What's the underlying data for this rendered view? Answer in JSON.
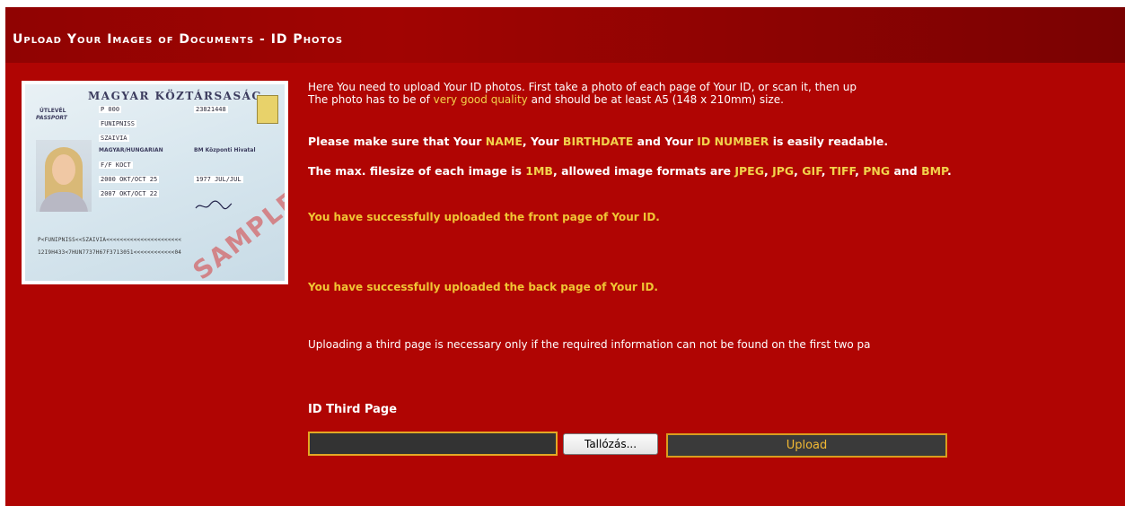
{
  "page": {
    "title": "Upload Your Images of Documents - ID Photos"
  },
  "sample_card": {
    "country": "MAGYAR KÖZTÁRSASÁG",
    "type_line1": "ÚTLEVÉL",
    "type_line2": "PASSPORT",
    "code": "P   000",
    "number": "23821448",
    "surname": "FUNIPNISS",
    "given_name": "SZAIVIA",
    "nationality": "MAGYAR/HUNGARIAN",
    "authority": "BM Központi Hivatal",
    "sex_place": "F/F    KOCT",
    "issue_date": "2000 OKT/OCT 25",
    "birth_date": "1977 JUL/JUL",
    "expiry_date": "2007 OKT/OCT 22",
    "mrz_line1": "P<FUNIPNISS<<SZAIVIA<<<<<<<<<<<<<<<<<<<<<<",
    "mrz_line2": "12I9H433<7HUN7737H67F3713051<<<<<<<<<<<<04",
    "stamp": "SAMPLE"
  },
  "intro": {
    "line1": "Here You need to upload Your ID photos. First take a photo of each page of Your ID, or scan it, then up",
    "line2_before": "The photo has to be of ",
    "line2_highlight": "very good quality",
    "line2_after": " and should be at least A5 (148 x 210mm) size."
  },
  "make_sure": {
    "t1": "Please make sure that Your ",
    "h1": "NAME",
    "t2": ", Your ",
    "h2": "BIRTHDATE",
    "t3": " and Your ",
    "h3": "ID NUMBER",
    "t4": " is easily readable."
  },
  "filesize": {
    "t1": "The max. filesize of each image is ",
    "h1": "1MB",
    "t2": ", allowed image formats are ",
    "f1": "JPEG",
    "s1": ", ",
    "f2": "JPG",
    "s2": ", ",
    "f3": "GIF",
    "s3": ", ",
    "f4": "TIFF",
    "s4": ", ",
    "f5": "PNG",
    "t3": " and ",
    "f6": "BMP",
    "t4": "."
  },
  "messages": {
    "front": "You have successfully uploaded the front page of Your ID.",
    "back": "You have successfully uploaded the back page of Your ID.",
    "third_note": "Uploading a third page is necessary only if the required information can not be found on the first two pa"
  },
  "upload_form": {
    "label": "ID Third Page",
    "file_value": "",
    "browse_label": "Tallózás...",
    "upload_label": "Upload"
  },
  "colors": {
    "background": "#b00503",
    "highlight": "#f2d24b",
    "button_border": "#d99d1e"
  }
}
